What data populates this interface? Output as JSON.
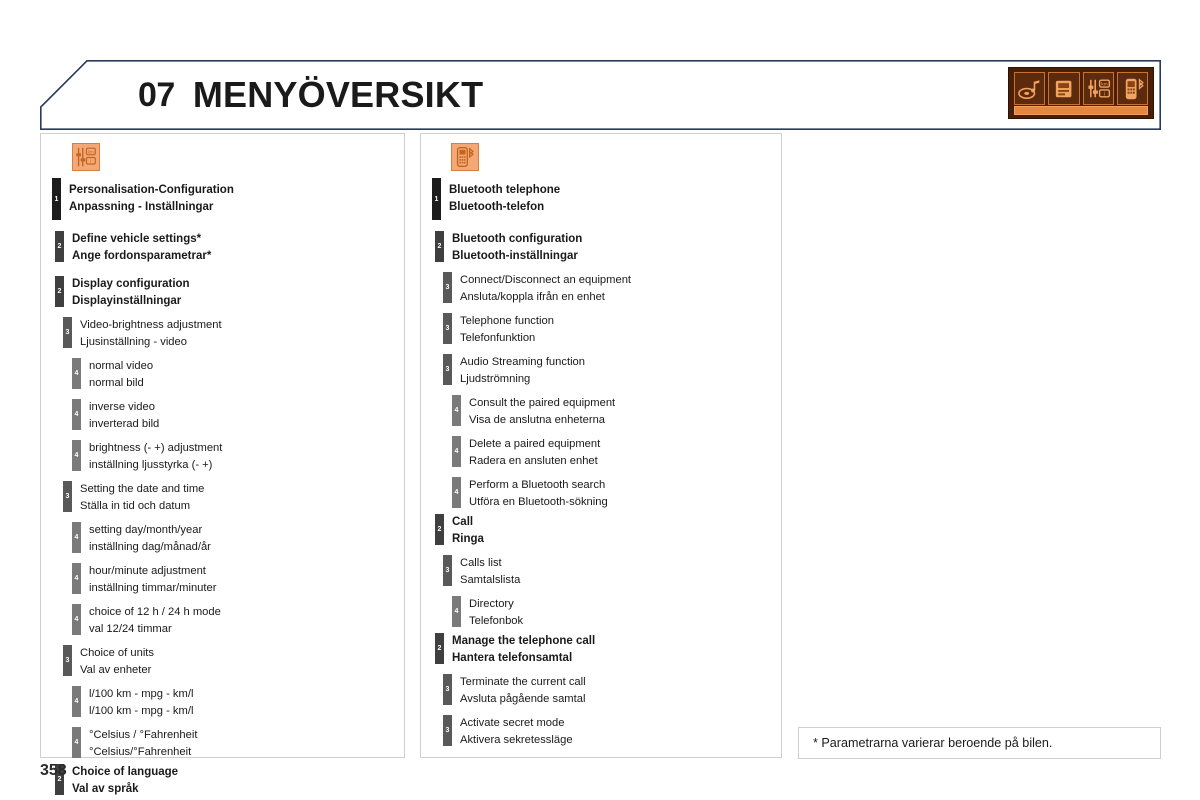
{
  "page": {
    "number": "358",
    "chapter_number": "07",
    "chapter_title": "MENYÖVERSIKT"
  },
  "header": {
    "icon_strip": {
      "name": "header-icon-strip",
      "background_color": "#4a1f08",
      "accent_color": "#e8863c",
      "tiles": [
        {
          "name": "media-audio-icon",
          "label": "media-audio"
        },
        {
          "name": "trip-computer-icon",
          "label": "trip-computer"
        },
        {
          "name": "vehicle-settings-icon",
          "label": "vehicle-settings"
        },
        {
          "name": "bluetooth-phone-icon",
          "label": "bluetooth-phone"
        }
      ]
    },
    "frame_color": "#2a3a5c"
  },
  "panels": [
    {
      "id": "personalisation",
      "icon_name": "personalisation-configuration-icon",
      "icon_color": "#f3a977",
      "items": [
        {
          "level": 1,
          "marker": "1",
          "en": "Personalisation-Configuration",
          "sv": "Anpassning - Inställningar"
        },
        {
          "level": 2,
          "marker": "2",
          "en": "Define vehicle settings*",
          "sv": "Ange fordonsparametrar*"
        },
        {
          "level": 2,
          "marker": "2",
          "en": "Display configuration",
          "sv": "Displayinställningar"
        },
        {
          "level": 3,
          "marker": "3",
          "en": "Video-brightness adjustment",
          "sv": "Ljusinställning - video"
        },
        {
          "level": 4,
          "marker": "4",
          "en": "normal video",
          "sv": "normal bild"
        },
        {
          "level": 4,
          "marker": "4",
          "en": "inverse video",
          "sv": "inverterad bild"
        },
        {
          "level": 4,
          "marker": "4",
          "en": "brightness (- +) adjustment",
          "sv": "inställning ljusstyrka (- +)"
        },
        {
          "level": 3,
          "marker": "3",
          "en": "Setting the date and time",
          "sv": "Ställa in tid och datum"
        },
        {
          "level": 4,
          "marker": "4",
          "en": "setting day/month/year",
          "sv": "inställning dag/månad/år"
        },
        {
          "level": 4,
          "marker": "4",
          "en": "hour/minute adjustment",
          "sv": "inställning timmar/minuter"
        },
        {
          "level": 4,
          "marker": "4",
          "en": "choice of 12 h / 24 h mode",
          "sv": "val 12/24 timmar"
        },
        {
          "level": 3,
          "marker": "3",
          "en": "Choice of units",
          "sv": "Val av enheter"
        },
        {
          "level": 4,
          "marker": "4",
          "en": "l/100 km - mpg - km/l",
          "sv": "l/100 km - mpg - km/l"
        },
        {
          "level": 4,
          "marker": "4",
          "en": "°Celsius / °Fahrenheit",
          "sv": "°Celsius/°Fahrenheit"
        },
        {
          "level": 2,
          "marker": "2",
          "en": "Choice of language",
          "sv": "Val av språk"
        }
      ]
    },
    {
      "id": "bluetooth-telephone",
      "icon_name": "bluetooth-telephone-icon",
      "icon_color": "#f3a977",
      "items": [
        {
          "level": 1,
          "marker": "1",
          "en": "Bluetooth telephone",
          "sv": "Bluetooth-telefon"
        },
        {
          "level": 2,
          "marker": "2",
          "en": "Bluetooth configuration",
          "sv": "Bluetooth-inställningar"
        },
        {
          "level": 3,
          "marker": "3",
          "en": "Connect/Disconnect an equipment",
          "sv": "Ansluta/koppla ifrån en enhet"
        },
        {
          "level": 3,
          "marker": "3",
          "en": "Telephone function",
          "sv": "Telefonfunktion"
        },
        {
          "level": 3,
          "marker": "3",
          "en": "Audio Streaming function",
          "sv": "Ljudströmning"
        },
        {
          "level": 4,
          "marker": "4",
          "en": "Consult the paired equipment",
          "sv": "Visa de anslutna enheterna"
        },
        {
          "level": 4,
          "marker": "4",
          "en": "Delete a paired equipment",
          "sv": "Radera en ansluten enhet"
        },
        {
          "level": 4,
          "marker": "4",
          "en": "Perform a Bluetooth search",
          "sv": "Utföra en Bluetooth-sökning"
        },
        {
          "level": 2,
          "marker": "2",
          "en": "Call",
          "sv": "Ringa"
        },
        {
          "level": 3,
          "marker": "3",
          "en": "Calls list",
          "sv": "Samtalslista"
        },
        {
          "level": 4,
          "marker": "4",
          "en": "Directory",
          "sv": "Telefonbok"
        },
        {
          "level": 2,
          "marker": "2",
          "en": "Manage the telephone call",
          "sv": "Hantera telefonsamtal"
        },
        {
          "level": 3,
          "marker": "3",
          "en": "Terminate the current call",
          "sv": "Avsluta pågående samtal"
        },
        {
          "level": 3,
          "marker": "3",
          "en": "Activate secret mode",
          "sv": "Aktivera sekretessläge"
        }
      ]
    }
  ],
  "footnote": {
    "text": "* Parametrarna varierar beroende på bilen."
  }
}
